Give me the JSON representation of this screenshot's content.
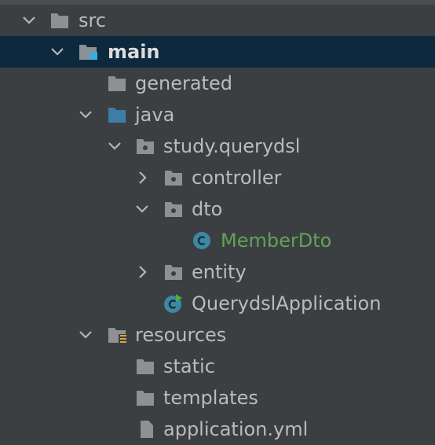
{
  "colors": {
    "background": "#3c3f41",
    "selection": "#0d293e",
    "folder": "#8e9194",
    "source_folder": "#3d7ea6",
    "class_icon": "#3d88a4",
    "modified_text": "#62a357",
    "resource_marker": "#d9a343",
    "run_marker": "#47b04a"
  },
  "tree": {
    "src": {
      "label": "src",
      "icon": "folder-icon"
    },
    "main": {
      "label": "main",
      "icon": "module-folder-icon"
    },
    "generated": {
      "label": "generated",
      "icon": "folder-icon"
    },
    "java": {
      "label": "java",
      "icon": "source-folder-icon"
    },
    "package": {
      "label": "study.querydsl",
      "icon": "package-icon"
    },
    "controller": {
      "label": "controller",
      "icon": "package-icon"
    },
    "dto": {
      "label": "dto",
      "icon": "package-icon"
    },
    "member_dto": {
      "label": "MemberDto",
      "icon": "class-icon"
    },
    "entity": {
      "label": "entity",
      "icon": "package-icon"
    },
    "app": {
      "label": "QuerydslApplication",
      "icon": "spring-boot-class-icon"
    },
    "resources": {
      "label": "resources",
      "icon": "resources-folder-icon"
    },
    "static": {
      "label": "static",
      "icon": "folder-icon"
    },
    "templates": {
      "label": "templates",
      "icon": "folder-icon"
    },
    "application_yml": {
      "label": "application.yml",
      "icon": "yaml-file-icon"
    }
  }
}
